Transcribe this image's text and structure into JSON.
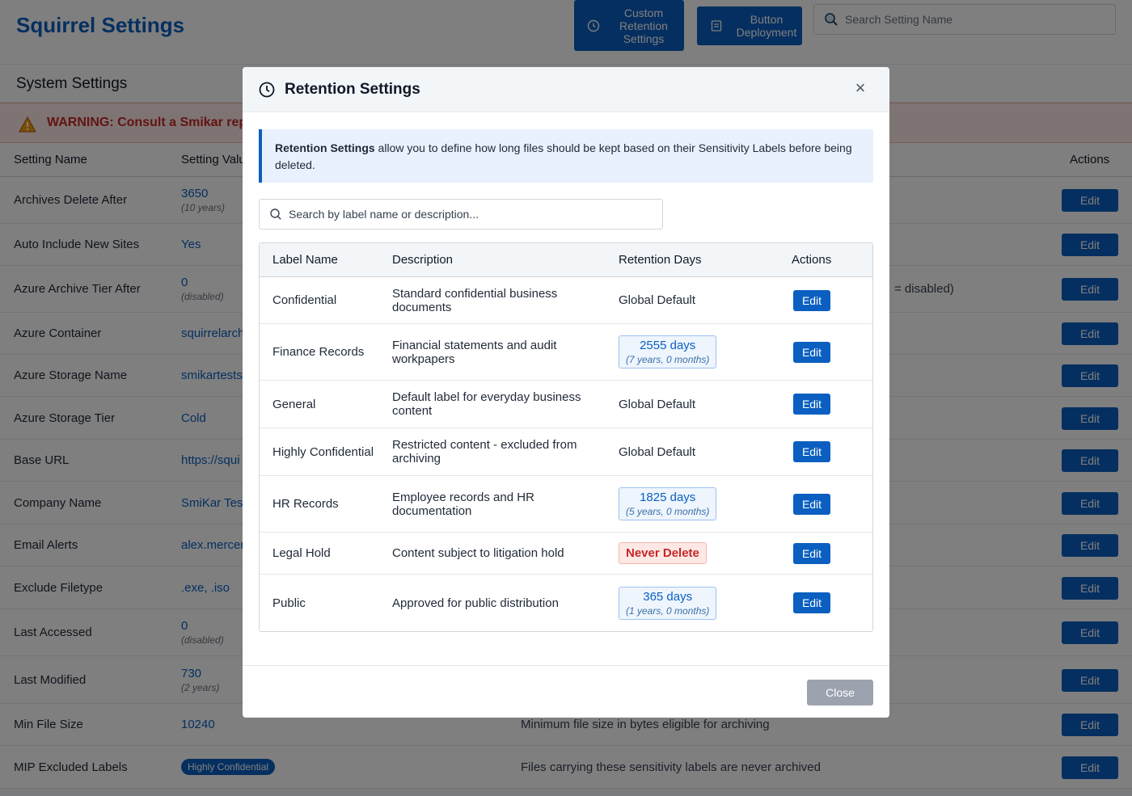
{
  "app": {
    "title": "Squirrel Settings",
    "custom_retention_label": "Custom Retention Settings",
    "button_deployment_label": "Button Deployment",
    "search_placeholder": "Search Setting Name"
  },
  "section": {
    "title": "System Settings",
    "warning": "WARNING: Consult a Smikar rep"
  },
  "settings_table": {
    "headers": {
      "name": "Setting Name",
      "value": "Setting Valu",
      "actions": "Actions"
    },
    "edit_label": "Edit",
    "rows": [
      {
        "name": "Archives Delete After",
        "value": "3650",
        "sub": "(10 years)",
        "desc": "",
        "desc2": ""
      },
      {
        "name": "Auto Include New Sites",
        "value": "Yes",
        "sub": "",
        "desc": "",
        "desc2": ""
      },
      {
        "name": "Azure Archive Tier After",
        "value": "0",
        "sub": "(disabled)",
        "desc": "",
        "desc2": "= disabled)"
      },
      {
        "name": "Azure Container",
        "value": "squirrelarch",
        "sub": "",
        "desc": "",
        "desc2": ""
      },
      {
        "name": "Azure Storage Name",
        "value": "smikartests",
        "sub": "",
        "desc": "",
        "desc2": ""
      },
      {
        "name": "Azure Storage Tier",
        "value": "Cold",
        "sub": "",
        "desc": "",
        "desc2": ""
      },
      {
        "name": "Base URL",
        "value": "https://squi",
        "sub": "",
        "desc": "",
        "desc2": ""
      },
      {
        "name": "Company Name",
        "value": "SmiKar Tes",
        "sub": "",
        "desc": "",
        "desc2": ""
      },
      {
        "name": "Email Alerts",
        "value": "alex.mercer",
        "sub": "",
        "desc": "",
        "desc2": ""
      },
      {
        "name": "Exclude Filetype",
        "value": ".exe, .iso",
        "sub": "",
        "desc": "",
        "desc2": ""
      },
      {
        "name": "Last Accessed",
        "value": "0",
        "sub": "(disabled)",
        "desc": "",
        "desc2": ""
      },
      {
        "name": "Last Modified",
        "value": "730",
        "sub": "(2 years)",
        "desc": "",
        "desc2": ""
      },
      {
        "name": "Min File Size",
        "value": "10240",
        "sub": "",
        "desc": "Minimum file size in bytes eligible for archiving",
        "desc2": ""
      },
      {
        "name": "MIP Excluded Labels",
        "value": "Highly Confidential",
        "sub": "",
        "desc": "Files carrying these sensitivity labels are never archived",
        "desc2": ""
      }
    ]
  },
  "modal": {
    "title": "Retention Settings",
    "close_symbol": "×",
    "info_bold": "Retention Settings",
    "info_text": " allow you to define how long files should be kept based on their Sensitivity Labels before being deleted.",
    "search_placeholder": "Search by label name or description...",
    "headers": {
      "label": "Label Name",
      "description": "Description",
      "days": "Retention Days",
      "actions": "Actions"
    },
    "edit_label": "Edit",
    "close_label": "Close",
    "rows": [
      {
        "label": "Confidential",
        "description": "Standard confidential business documents",
        "days_text": "Global Default",
        "days_sub": "",
        "kind": "default"
      },
      {
        "label": "Finance Records",
        "description": "Financial statements and audit workpapers",
        "days_text": "2555 days",
        "days_sub": "(7 years, 0 months)",
        "kind": "badge"
      },
      {
        "label": "General",
        "description": "Default label for everyday business content",
        "days_text": "Global Default",
        "days_sub": "",
        "kind": "default"
      },
      {
        "label": "Highly Confidential",
        "description": "Restricted content - excluded from archiving",
        "days_text": "Global Default",
        "days_sub": "",
        "kind": "default"
      },
      {
        "label": "HR Records",
        "description": "Employee records and HR documentation",
        "days_text": "1825 days",
        "days_sub": "(5 years, 0 months)",
        "kind": "badge"
      },
      {
        "label": "Legal Hold",
        "description": "Content subject to litigation hold",
        "days_text": "Never Delete",
        "days_sub": "",
        "kind": "never"
      },
      {
        "label": "Public",
        "description": "Approved for public distribution",
        "days_text": "365 days",
        "days_sub": "(1 years, 0 months)",
        "kind": "badge"
      }
    ]
  },
  "colors": {
    "primary": "#0a5fc0",
    "danger": "#c62828",
    "info_bg": "#e8f1fd"
  }
}
